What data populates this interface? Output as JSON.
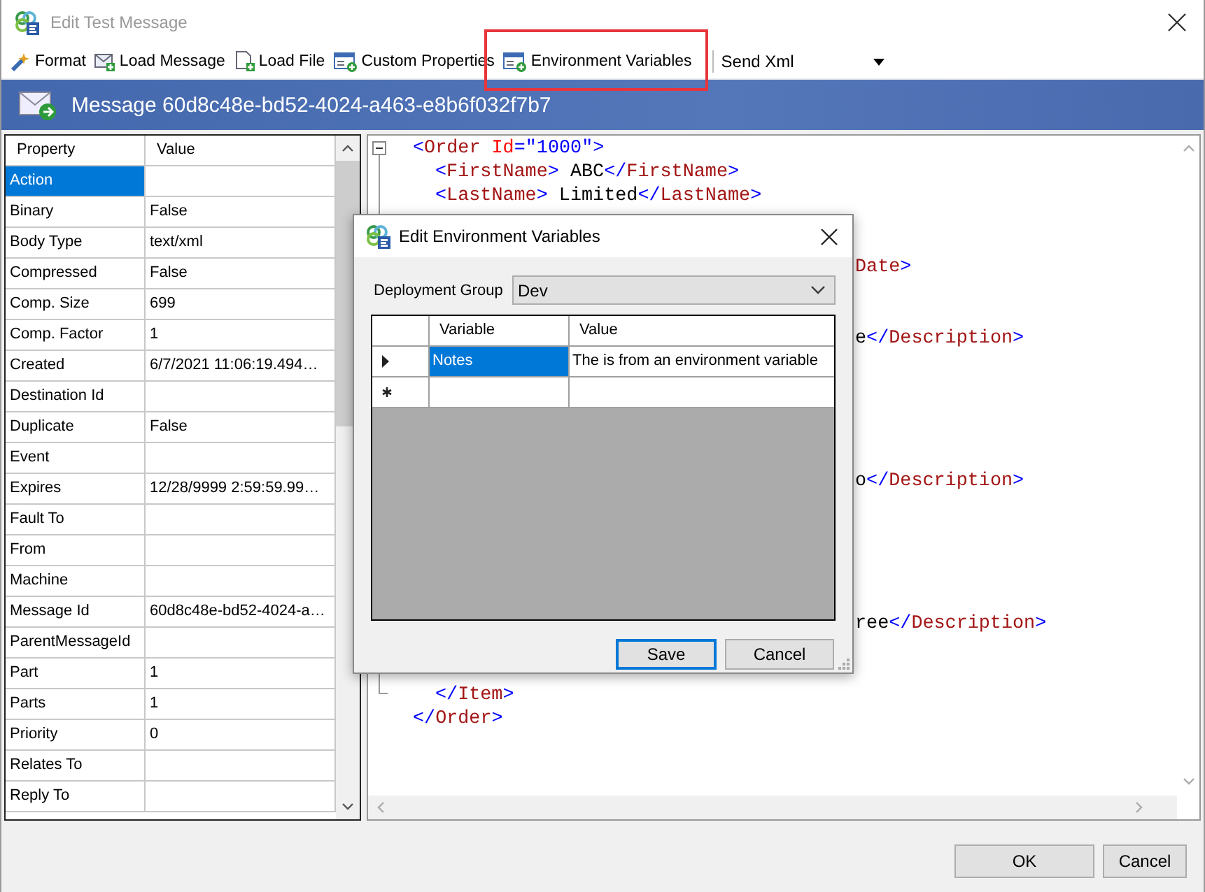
{
  "window": {
    "title": "Edit Test Message"
  },
  "toolbar": {
    "items": [
      {
        "label": "Format",
        "kind": "format",
        "highlighted": false
      },
      {
        "label": "Load Message",
        "kind": "message",
        "highlighted": false
      },
      {
        "label": "Load File",
        "kind": "file",
        "highlighted": false
      },
      {
        "label": "Custom Properties",
        "kind": "props",
        "highlighted": false
      },
      {
        "label": "Environment Variables",
        "kind": "props",
        "highlighted": true
      }
    ],
    "send": {
      "value": "Send Xml"
    }
  },
  "header": {
    "title": "Message 60d8c48e-bd52-4024-a463-e8b6f032f7b7"
  },
  "properties": {
    "columns": [
      "Property",
      "Value"
    ],
    "rows": [
      {
        "name": "Action",
        "selected": true
      },
      {
        "name": "Binary",
        "value": "False",
        "selected": false
      },
      {
        "name": "Body Type",
        "value": "text/xml",
        "selected": false
      },
      {
        "name": "Compressed",
        "value": "False",
        "selected": false
      },
      {
        "name": "Comp. Size",
        "value": "699",
        "selected": false
      },
      {
        "name": "Comp. Factor",
        "value": "1",
        "selected": false
      },
      {
        "name": "Created",
        "value": "6/7/2021 11:06:19.494…",
        "selected": false
      },
      {
        "name": "Destination Id",
        "selected": false
      },
      {
        "name": "Duplicate",
        "value": "False",
        "selected": false
      },
      {
        "name": "Event",
        "selected": false
      },
      {
        "name": "Expires",
        "value": "12/28/9999 2:59:59.99…",
        "selected": false
      },
      {
        "name": "Fault To",
        "selected": false
      },
      {
        "name": "From",
        "selected": false
      },
      {
        "name": "Machine",
        "selected": false
      },
      {
        "name": "Message Id",
        "value": "60d8c48e-bd52-4024-a…",
        "selected": false
      },
      {
        "name": "ParentMessageId",
        "selected": false
      },
      {
        "name": "Part",
        "value": "1",
        "selected": false
      },
      {
        "name": "Parts",
        "value": "1",
        "selected": false
      },
      {
        "name": "Priority",
        "value": "0",
        "selected": false
      },
      {
        "name": "Relates To",
        "selected": false
      },
      {
        "name": "Reply To",
        "selected": false
      }
    ]
  },
  "editor": {
    "lines": [
      {
        "kind": "root",
        "segments": [
          {
            "kind": "punct",
            "text": "<"
          },
          {
            "kind": "tag",
            "text": "Order"
          },
          {
            "kind": "attr",
            "text": " Id"
          },
          {
            "kind": "punct",
            "text": "="
          },
          {
            "kind": "value",
            "text": "\"1000\""
          },
          {
            "kind": "punct",
            "text": ">"
          }
        ]
      },
      {
        "kind": "child",
        "segments": [
          {
            "kind": "punct",
            "text": "<"
          },
          {
            "kind": "tag",
            "text": "FirstName"
          },
          {
            "kind": "punct",
            "text": ">"
          },
          {
            "kind": "text",
            "text": " ABC"
          },
          {
            "kind": "punct",
            "text": "</"
          },
          {
            "kind": "tag",
            "text": "FirstName"
          },
          {
            "kind": "punct",
            "text": ">"
          }
        ]
      },
      {
        "kind": "child",
        "segments": [
          {
            "kind": "punct",
            "text": "<"
          },
          {
            "kind": "tag",
            "text": "LastName"
          },
          {
            "kind": "punct",
            "text": ">"
          },
          {
            "kind": "text",
            "text": " Limited"
          },
          {
            "kind": "punct",
            "text": "</"
          },
          {
            "kind": "tag",
            "text": "LastName"
          },
          {
            "kind": "punct",
            "text": ">"
          }
        ]
      },
      {
        "kind": "tail",
        "segments": [
          {
            "kind": "tag",
            "text": "Date"
          },
          {
            "kind": "punct",
            "text": ">"
          }
        ]
      },
      {
        "kind": "tail",
        "segments": [
          {
            "kind": "text",
            "text": "e"
          },
          {
            "kind": "punct",
            "text": "</"
          },
          {
            "kind": "tag",
            "text": "Description"
          },
          {
            "kind": "punct",
            "text": ">"
          }
        ]
      },
      {
        "kind": "tail",
        "segments": [
          {
            "kind": "text",
            "text": "o"
          },
          {
            "kind": "punct",
            "text": "</"
          },
          {
            "kind": "tag",
            "text": "Description"
          },
          {
            "kind": "punct",
            "text": ">"
          }
        ]
      },
      {
        "kind": "tail",
        "segments": [
          {
            "kind": "text",
            "text": "ree"
          },
          {
            "kind": "punct",
            "text": "</"
          },
          {
            "kind": "tag",
            "text": "Description"
          },
          {
            "kind": "punct",
            "text": ">"
          }
        ]
      },
      {
        "kind": "child",
        "segments": [
          {
            "kind": "punct",
            "text": "</"
          },
          {
            "kind": "tag",
            "text": "Item"
          },
          {
            "kind": "punct",
            "text": ">"
          }
        ]
      },
      {
        "kind": "root",
        "segments": [
          {
            "kind": "punct",
            "text": "</"
          },
          {
            "kind": "tag",
            "text": "Order"
          },
          {
            "kind": "punct",
            "text": ">"
          }
        ]
      }
    ]
  },
  "dialog": {
    "title": "Edit Environment Variables",
    "group_label": "Deployment Group",
    "group_value": "Dev",
    "columns": [
      "Variable",
      "Value"
    ],
    "rows": [
      {
        "kind": "current",
        "variable": "Notes",
        "value": "The is from an environment variable",
        "selected": true
      },
      {
        "kind": "new",
        "selected": false
      }
    ],
    "buttons": [
      {
        "label": "Save",
        "default": true
      },
      {
        "label": "Cancel",
        "default": false
      }
    ]
  },
  "buttons": [
    "OK",
    "Cancel"
  ]
}
